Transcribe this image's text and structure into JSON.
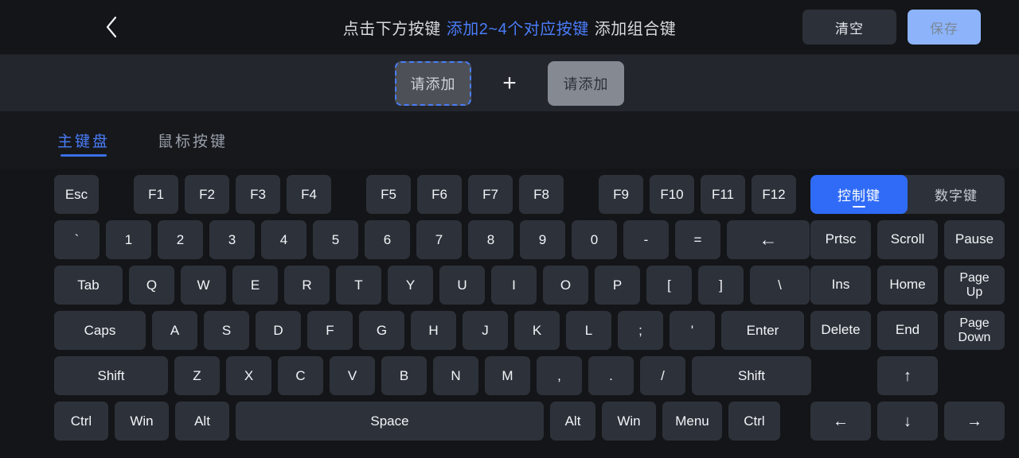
{
  "header": {
    "back_icon": "chevron-left-icon",
    "title_prefix": "点击下方按键",
    "title_accent": "添加2~4个对应按键",
    "title_suffix": "添加组合键",
    "clear_label": "清空",
    "save_label": "保存"
  },
  "slots": {
    "slot1_label": "请添加",
    "plus_label": "+",
    "slot2_label": "请添加"
  },
  "tabs": [
    {
      "label": "主键盘",
      "active": true
    },
    {
      "label": "鼠标按键",
      "active": false
    }
  ],
  "toggle": {
    "left_label": "控制键",
    "right_label": "数字键",
    "active": "left"
  },
  "keyboard": {
    "row_fn": [
      "Esc",
      "F1",
      "F2",
      "F3",
      "F4",
      "F5",
      "F6",
      "F7",
      "F8",
      "F9",
      "F10",
      "F11",
      "F12"
    ],
    "row_num": [
      "`",
      "1",
      "2",
      "3",
      "4",
      "5",
      "6",
      "7",
      "8",
      "9",
      "0",
      "-",
      "=",
      "←"
    ],
    "row_qwerty": [
      "Tab",
      "Q",
      "W",
      "E",
      "R",
      "T",
      "Y",
      "U",
      "I",
      "O",
      "P",
      "[",
      "]",
      "\\"
    ],
    "row_home": [
      "Caps",
      "A",
      "S",
      "D",
      "F",
      "G",
      "H",
      "J",
      "K",
      "L",
      ";",
      "'",
      "Enter"
    ],
    "row_shift": [
      "Shift",
      "Z",
      "X",
      "C",
      "V",
      "B",
      "N",
      "M",
      ",",
      ".",
      "/",
      "Shift"
    ],
    "row_bottom": [
      "Ctrl",
      "Win",
      "Alt",
      "Space",
      "Alt",
      "Win",
      "Menu",
      "Ctrl"
    ]
  },
  "nav_cluster": {
    "row1": [
      "Prtsc",
      "Scroll",
      "Pause"
    ],
    "row2": [
      "Ins",
      "Home",
      "Page\nUp"
    ],
    "row3": [
      "Delete",
      "End",
      "Page\nDown"
    ],
    "arrow_up": "↑",
    "arrow_left": "←",
    "arrow_down": "↓",
    "arrow_right": "→"
  },
  "colors": {
    "accent_blue": "#4a7dfa",
    "toggle_blue": "#2f6bf6",
    "save_blue": "#8db4fb",
    "key_bg": "#2d323a",
    "page_bg": "#141518",
    "slotbar_bg": "#23262c"
  }
}
